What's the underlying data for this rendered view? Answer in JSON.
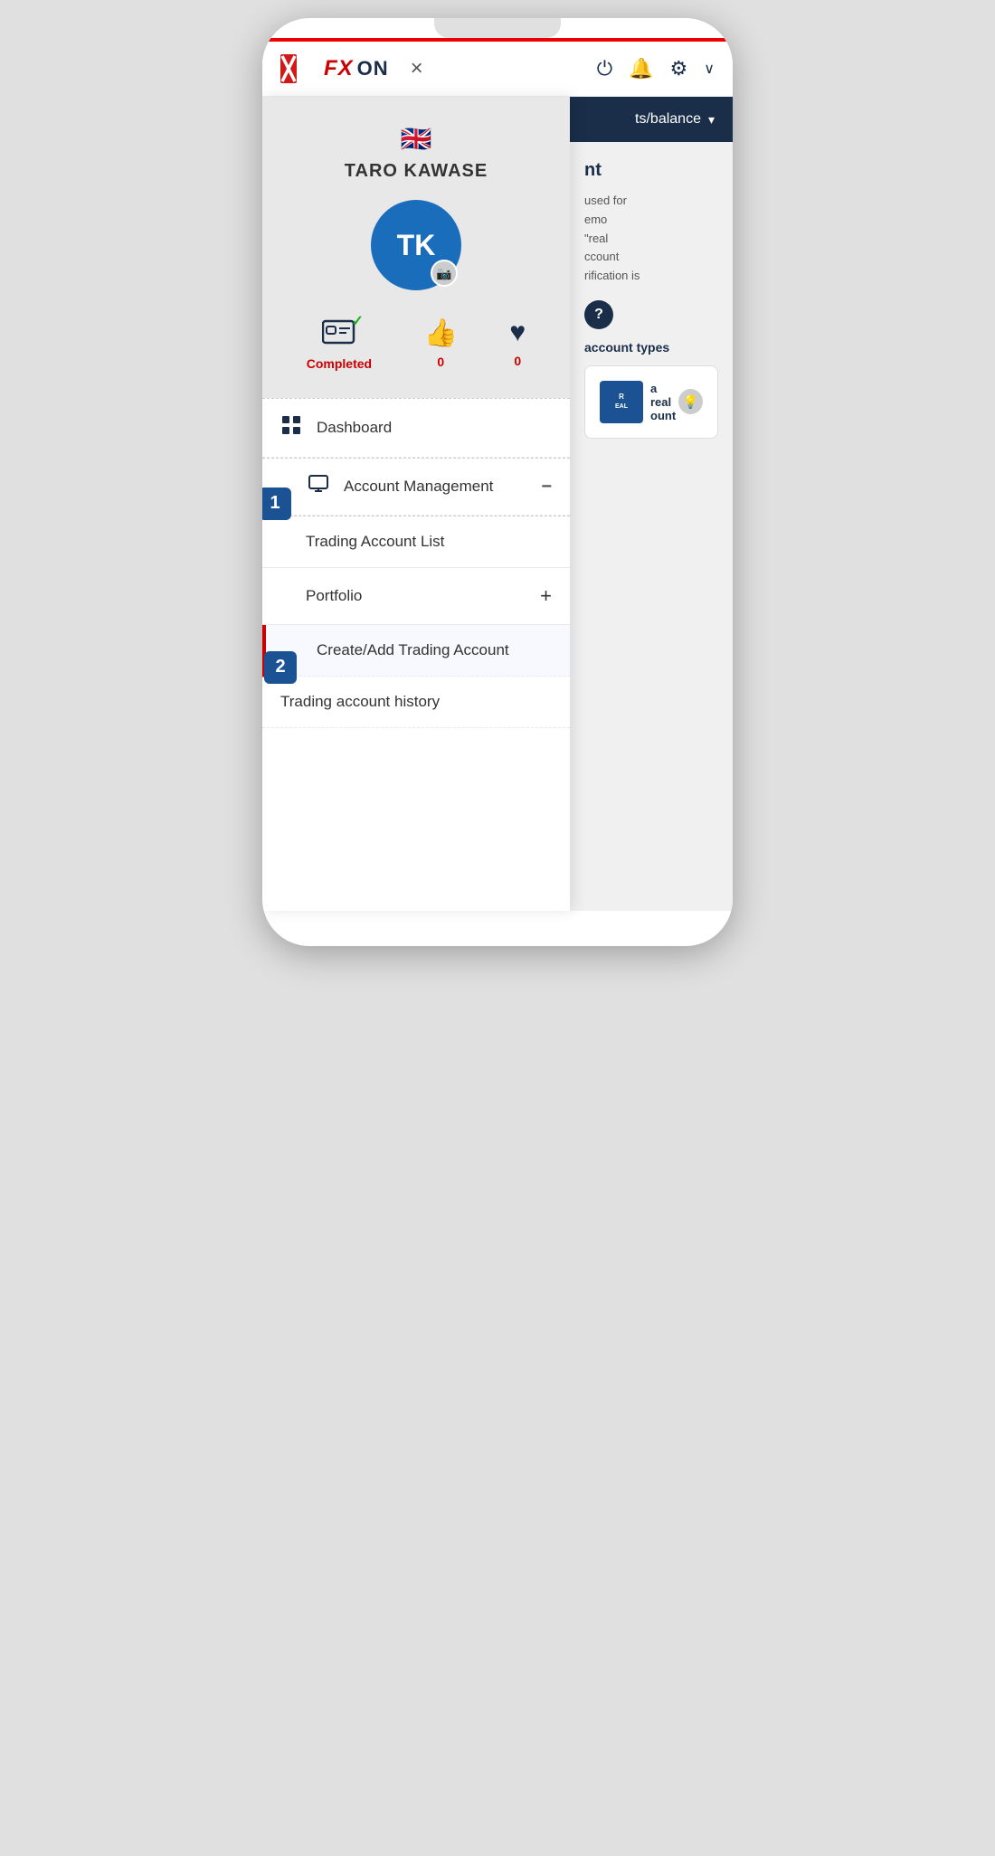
{
  "phone": {
    "header": {
      "logo_text": "FXON",
      "close_label": "×",
      "power_icon": "⏻",
      "bell_icon": "🔔",
      "gear_icon": "⚙",
      "chevron": "∨"
    },
    "right_panel": {
      "header_text": "ts/balance",
      "chevron": "▾",
      "title": "nt",
      "description_parts": [
        "used for",
        "emo",
        "\"real",
        "ccount",
        "rification is"
      ],
      "question_label": "?",
      "account_types_label": "account types",
      "account_card": {
        "badge_text": "EAL",
        "bulb": "💡",
        "text1": "a real",
        "text2": "ount"
      }
    },
    "sidebar": {
      "flag": "🇬🇧",
      "user_name": "TARO KAWASE",
      "avatar_initials": "TK",
      "camera_icon": "📷",
      "stats": [
        {
          "icon": "🪪",
          "label": "Completed",
          "value": null,
          "has_check": true
        },
        {
          "icon": "👍",
          "label": null,
          "value": "0"
        },
        {
          "icon": "❤️",
          "label": null,
          "value": "0"
        }
      ],
      "menu_items": [
        {
          "id": "dashboard",
          "icon": "⊞",
          "label": "Dashboard",
          "badge": null,
          "indent": false,
          "expand": null,
          "step": false
        },
        {
          "id": "account-management",
          "icon": "🖥",
          "label": "Account Management",
          "badge": null,
          "indent": false,
          "expand": "−",
          "step": false,
          "badge_num": "1"
        },
        {
          "id": "trading-account-list",
          "icon": null,
          "label": "Trading Account List",
          "badge": null,
          "indent": true,
          "expand": null,
          "step": false
        },
        {
          "id": "portfolio",
          "icon": null,
          "label": "Portfolio",
          "badge": null,
          "indent": true,
          "expand": "+",
          "step": false
        },
        {
          "id": "create-add-trading-account",
          "icon": null,
          "label": "Create/Add Trading Account",
          "badge": null,
          "indent": false,
          "expand": null,
          "step": true,
          "badge_num": "2"
        },
        {
          "id": "trading-account-history",
          "icon": null,
          "label": "Trading account history",
          "badge": null,
          "indent": false,
          "expand": null,
          "step": false
        }
      ]
    }
  }
}
